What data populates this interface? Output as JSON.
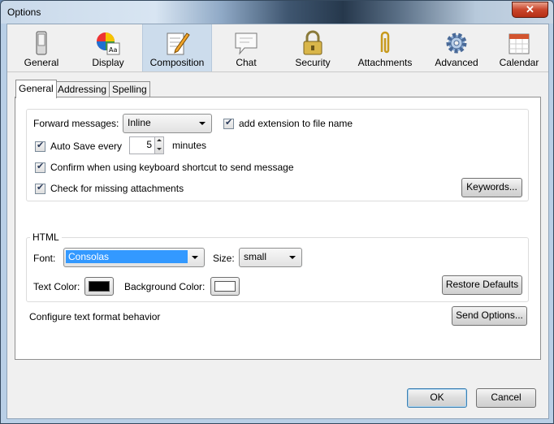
{
  "window": {
    "title": "Options",
    "close_glyph": "✕"
  },
  "panes": [
    {
      "label": "General",
      "icon": "phone-icon"
    },
    {
      "label": "Display",
      "icon": "color-wheel-icon"
    },
    {
      "label": "Composition",
      "icon": "composition-pencil-icon",
      "selected": true
    },
    {
      "label": "Chat",
      "icon": "chat-bubble-icon"
    },
    {
      "label": "Security",
      "icon": "padlock-icon"
    },
    {
      "label": "Attachments",
      "icon": "paperclip-icon"
    },
    {
      "label": "Advanced",
      "icon": "gear-icon"
    },
    {
      "label": "Calendar",
      "icon": "calendar-icon"
    }
  ],
  "tabs": [
    {
      "label": "General",
      "active": true
    },
    {
      "label": "Addressing"
    },
    {
      "label": "Spelling"
    }
  ],
  "general": {
    "forward_label": "Forward messages:",
    "forward_value": "Inline",
    "add_extension_label": "add extension to file name",
    "autosave_label": "Auto Save every",
    "autosave_value": "5",
    "autosave_unit": "minutes",
    "confirm_label": "Confirm when using keyboard shortcut to send message",
    "missing_label": "Check for missing attachments",
    "keywords_button": "Keywords..."
  },
  "html": {
    "legend": "HTML",
    "font_label": "Font:",
    "font_value": "Consolas",
    "size_label": "Size:",
    "size_value": "small",
    "text_color_label": "Text Color:",
    "text_color": "#000000",
    "bg_color_label": "Background Color:",
    "bg_color": "#ffffff",
    "restore_button": "Restore Defaults"
  },
  "format": {
    "label": "Configure text format behavior",
    "send_options_button": "Send Options..."
  },
  "dialog": {
    "ok": "OK",
    "cancel": "Cancel"
  },
  "colors": {
    "accent": "#3399ff",
    "selected_pane": "#ccdcec"
  }
}
